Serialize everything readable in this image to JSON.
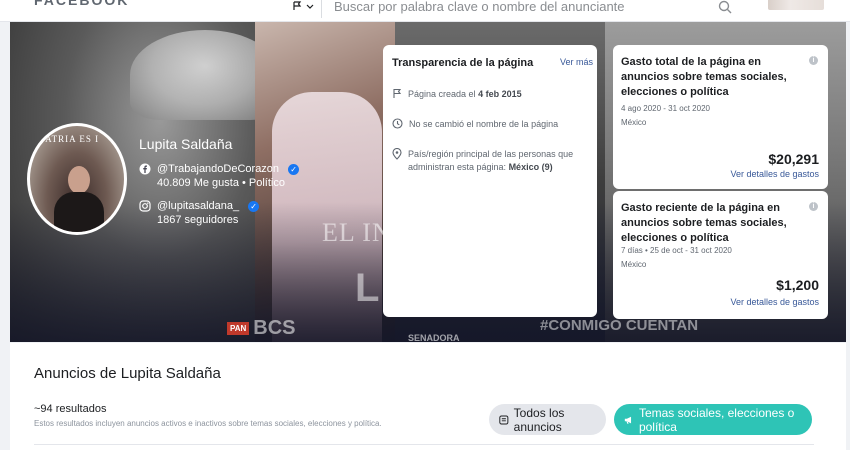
{
  "topbar": {
    "brand": "FACEBOOK",
    "search_placeholder": "Buscar por palabra clave o nombre del anunciante"
  },
  "hero": {
    "watermark": "EL INDEPENDIENTE",
    "poster_name": "LUPITA",
    "poster_party": "BCS",
    "poster_hashtag": "#CONMIGO CUENTAN",
    "poster_role": "SENADORA",
    "photo_caption": "PATRIA ES I"
  },
  "profile": {
    "name": "Lupita Saldaña",
    "facebook_handle": "@TrabajandoDeCorazon",
    "facebook_stats": "40.809 Me gusta • Político",
    "instagram_handle": "@lupitasaldana_",
    "instagram_stats": "1867 seguidores"
  },
  "transparency": {
    "title": "Transparencia de la página",
    "more_link": "Ver más",
    "created_label": "Página creada el ",
    "created_date": "4 feb 2015",
    "name_change": "No se cambió el nombre de la página",
    "country_label": "País/región principal de las personas que administran esta página: ",
    "country_value": "México (9)"
  },
  "spend_total": {
    "title": "Gasto total de la página en anuncios sobre temas sociales, elecciones o política",
    "date_range": "4 ago 2020 - 31 oct 2020",
    "country": "México",
    "amount": "$20,291",
    "link": "Ver detalles de gastos"
  },
  "spend_recent": {
    "title": "Gasto reciente de la página en anuncios sobre temas sociales, elecciones o política",
    "date_range": "7 días • 25 de oct - 31 oct 2020",
    "country": "México",
    "amount": "$1,200",
    "link": "Ver detalles de gastos"
  },
  "results": {
    "title": "Anuncios de Lupita Saldaña",
    "count": "~94 resultados",
    "description": "Estos resultados incluyen anuncios activos e inactivos sobre temas sociales, elecciones y política.",
    "btn_all": "Todos los anuncios",
    "btn_social": "Temas sociales, elecciones o política"
  },
  "colors": {
    "accent": "#2ec4b6",
    "link": "#385898",
    "verified": "#1877f2"
  }
}
